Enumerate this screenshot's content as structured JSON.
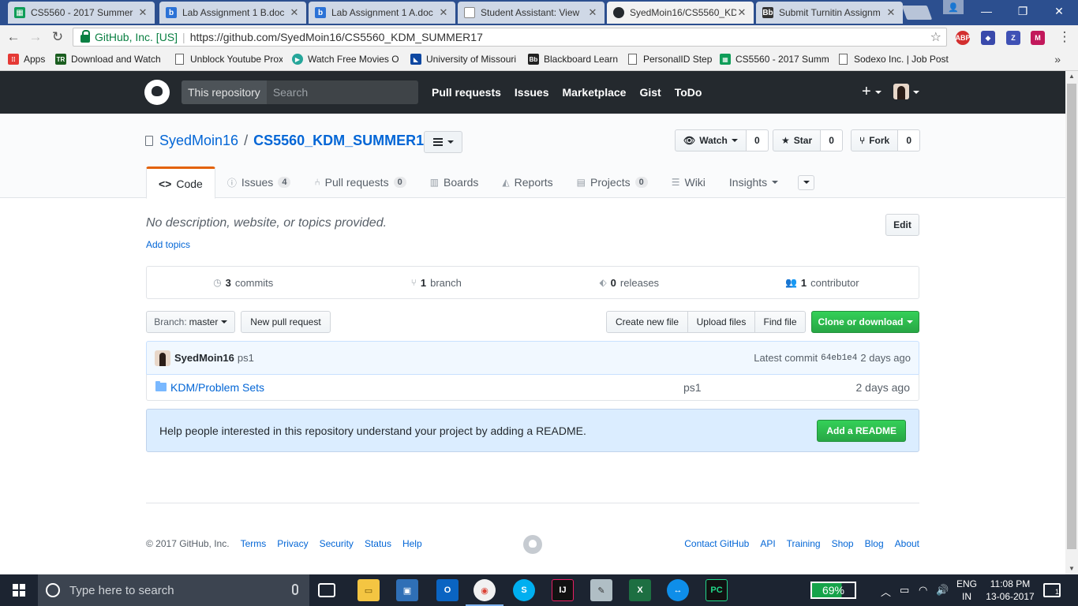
{
  "browser": {
    "tabs": [
      {
        "title": "CS5560 - 2017 Summer",
        "fav_color": "#0f9d58",
        "fav_glyph": "▦"
      },
      {
        "title": "Lab Assignment 1 B.doc",
        "fav_color": "#2b72d6",
        "fav_glyph": "b"
      },
      {
        "title": "Lab Assignment 1 A.doc",
        "fav_color": "#2b72d6",
        "fav_glyph": "b"
      },
      {
        "title": "Student Assistant: View",
        "fav_color": "#888888",
        "fav_glyph": ""
      },
      {
        "title": "SyedMoin16/CS5560_KD",
        "fav_color": "#24292e",
        "fav_glyph": "●"
      },
      {
        "title": "Submit Turnitin Assignm",
        "fav_color": "#333333",
        "fav_glyph": "Bb"
      }
    ],
    "secure_label": "GitHub, Inc. [US]",
    "url": "https://github.com/SyedMoin16/CS5560_KDM_SUMMER17",
    "bookmarks": [
      {
        "label": "Apps",
        "icon": "apps-grid-icon",
        "color": "#e53935"
      },
      {
        "label": "Download and Watch",
        "icon": "tr-icon",
        "color": "#1b5e20"
      },
      {
        "label": "Unblock Youtube Prox",
        "icon": "page-icon",
        "color": ""
      },
      {
        "label": "Watch Free Movies O",
        "icon": "play-icon",
        "color": "#26a69a"
      },
      {
        "label": "University of Missouri",
        "icon": "umkc-icon",
        "color": "#0d47a1"
      },
      {
        "label": "Blackboard Learn",
        "icon": "bb-icon",
        "color": "#222222"
      },
      {
        "label": "PersonalID Step",
        "icon": "page-icon",
        "color": ""
      },
      {
        "label": "CS5560 - 2017 Summ",
        "icon": "sheets-icon",
        "color": "#0f9d58"
      },
      {
        "label": "Sodexo Inc. | Job Post",
        "icon": "page-icon",
        "color": ""
      }
    ]
  },
  "github": {
    "search_scope": "This repository",
    "search_placeholder": "Search",
    "nav": [
      "Pull requests",
      "Issues",
      "Marketplace",
      "Gist",
      "ToDo"
    ],
    "owner": "SyedMoin16",
    "repo": "CS5560_KDM_SUMMER17",
    "watch": {
      "label": "Watch",
      "count": "0"
    },
    "star": {
      "label": "Star",
      "count": "0"
    },
    "fork": {
      "label": "Fork",
      "count": "0"
    },
    "tabs": [
      {
        "label": "Code",
        "counter": ""
      },
      {
        "label": "Issues",
        "counter": "4"
      },
      {
        "label": "Pull requests",
        "counter": "0"
      },
      {
        "label": "Boards",
        "counter": ""
      },
      {
        "label": "Reports",
        "counter": ""
      },
      {
        "label": "Projects",
        "counter": "0"
      },
      {
        "label": "Wiki",
        "counter": ""
      },
      {
        "label": "Insights",
        "counter": ""
      }
    ],
    "description": "No description, website, or topics provided.",
    "add_topics": "Add topics",
    "edit": "Edit",
    "numbers": [
      {
        "count": "3",
        "label": "commits"
      },
      {
        "count": "1",
        "label": "branch"
      },
      {
        "count": "0",
        "label": "releases"
      },
      {
        "count": "1",
        "label": "contributor"
      }
    ],
    "branch_label": "Branch:",
    "branch_value": "master",
    "new_pr": "New pull request",
    "create_file": "Create new file",
    "upload_files": "Upload files",
    "find_file": "Find file",
    "clone": "Clone or download",
    "commit": {
      "author": "SyedMoin16",
      "message": "ps1",
      "latest_label": "Latest commit",
      "sha": "64eb1e4",
      "age": "2 days ago"
    },
    "files": [
      {
        "prefix": "KDM/",
        "name": "Problem Sets",
        "message": "ps1",
        "age": "2 days ago"
      }
    ],
    "readme_prompt": "Help people interested in this repository understand your project by adding a README.",
    "readme_button": "Add a README",
    "footer_copyright": "© 2017 GitHub, Inc.",
    "footer_left": [
      "Terms",
      "Privacy",
      "Security",
      "Status",
      "Help"
    ],
    "footer_right": [
      "Contact GitHub",
      "API",
      "Training",
      "Shop",
      "Blog",
      "About"
    ]
  },
  "taskbar": {
    "search_placeholder": "Type here to search",
    "battery": "69%",
    "lang_1": "ENG",
    "lang_2": "IN",
    "time": "11:08 PM",
    "date": "13-06-2017",
    "notifications": "1"
  }
}
